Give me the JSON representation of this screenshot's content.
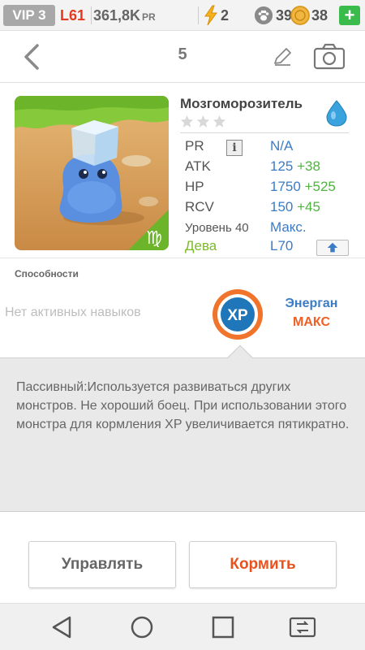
{
  "status_bar": {
    "vip": "VIP 3",
    "level": "L61",
    "pr_value": "361,8K",
    "pr_unit": "PR",
    "energy": "2",
    "food": "39K",
    "coins": "38",
    "add": "+"
  },
  "header": {
    "title": "5",
    "icons": [
      "back-chevron-icon",
      "pencil-icon",
      "camera-icon"
    ]
  },
  "monster": {
    "name": "Мозгоморозитель",
    "element_icon": "water-drop-icon",
    "stars_filled": 0,
    "stars_total": 3,
    "sign_icon": "virgo-icon",
    "stats": {
      "pr_label": "PR",
      "pr_value": "N/A",
      "atk_label": "ATK",
      "atk_value": "125",
      "atk_bonus": "+38",
      "hp_label": "HP",
      "hp_value": "1750",
      "hp_bonus": "+525",
      "rcv_label": "RCV",
      "rcv_value": "150",
      "rcv_bonus": "+45",
      "level_label": "Уровень 40",
      "level_value": "Макс.",
      "sign_label": "Дева",
      "sign_value": "L70"
    }
  },
  "abilities": {
    "heading": "Способности",
    "no_active": "Нет активных навыков",
    "badge_text": "XP",
    "passive_name": "Энерган",
    "passive_level": "МАКС",
    "description": "Пассивный:Используется развиваться других монстров. Не хороший боец. При использовании этого монстра для кормления XP увеличивается пятикратно."
  },
  "actions": {
    "manage": "Управлять",
    "feed": "Кормить"
  },
  "colors": {
    "accent_blue": "#3b7cc6",
    "bonus_green": "#4db53d",
    "feed_orange": "#e9521d",
    "level_red": "#e53a1f"
  }
}
